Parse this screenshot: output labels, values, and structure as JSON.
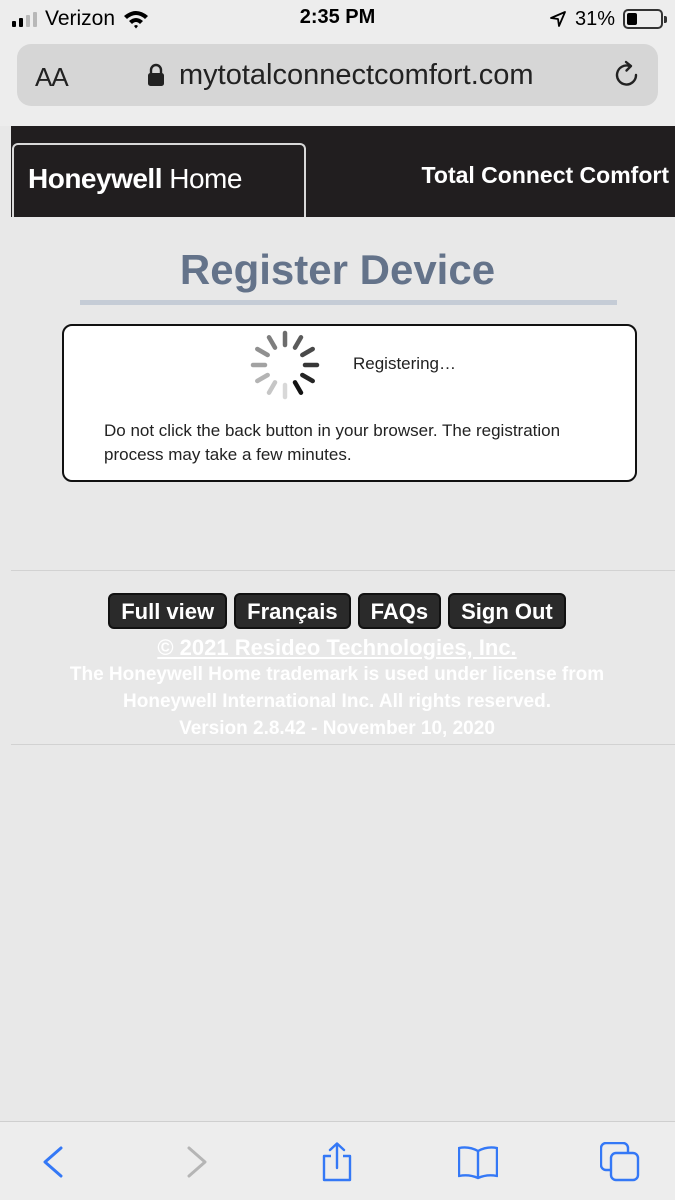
{
  "status_bar": {
    "carrier": "Verizon",
    "time": "2:35 PM",
    "battery_percent": "31%",
    "battery_level": 0.31,
    "signal_bars": 2,
    "icons": [
      "signal-icon",
      "wifi-icon",
      "location-arrow-icon",
      "battery-icon"
    ]
  },
  "browser": {
    "text_size_label": "AA",
    "url": "mytotalconnectcomfort.com",
    "icons": [
      "lock-icon",
      "reload-icon"
    ]
  },
  "header": {
    "logo_brand": "Honeywell",
    "logo_product": " Home",
    "title": "Total Connect Comfort",
    "colors": {
      "background": "#211e1f",
      "text": "#ffffff"
    }
  },
  "main": {
    "page_title": "Register Device",
    "status_text": "Registering…",
    "note": "Do not click the back button in your browser. The registration process may take a few minutes.",
    "colors": {
      "title": "#64738a",
      "rule": "#c5ccd6"
    }
  },
  "footer": {
    "buttons": [
      "Full view",
      "Français",
      "FAQs",
      "Sign Out"
    ],
    "copyright": "© 2021 Resideo Technologies, Inc.",
    "trademark_line1": "The Honeywell Home trademark is used under license from",
    "trademark_line2": "Honeywell International Inc. All rights reserved.",
    "version": "Version 2.8.42 - November 10, 2020"
  },
  "toolbar": {
    "icons": [
      "back-icon",
      "forward-icon",
      "share-icon",
      "bookmarks-icon",
      "tabs-icon"
    ],
    "accent_color": "#3478f6"
  }
}
